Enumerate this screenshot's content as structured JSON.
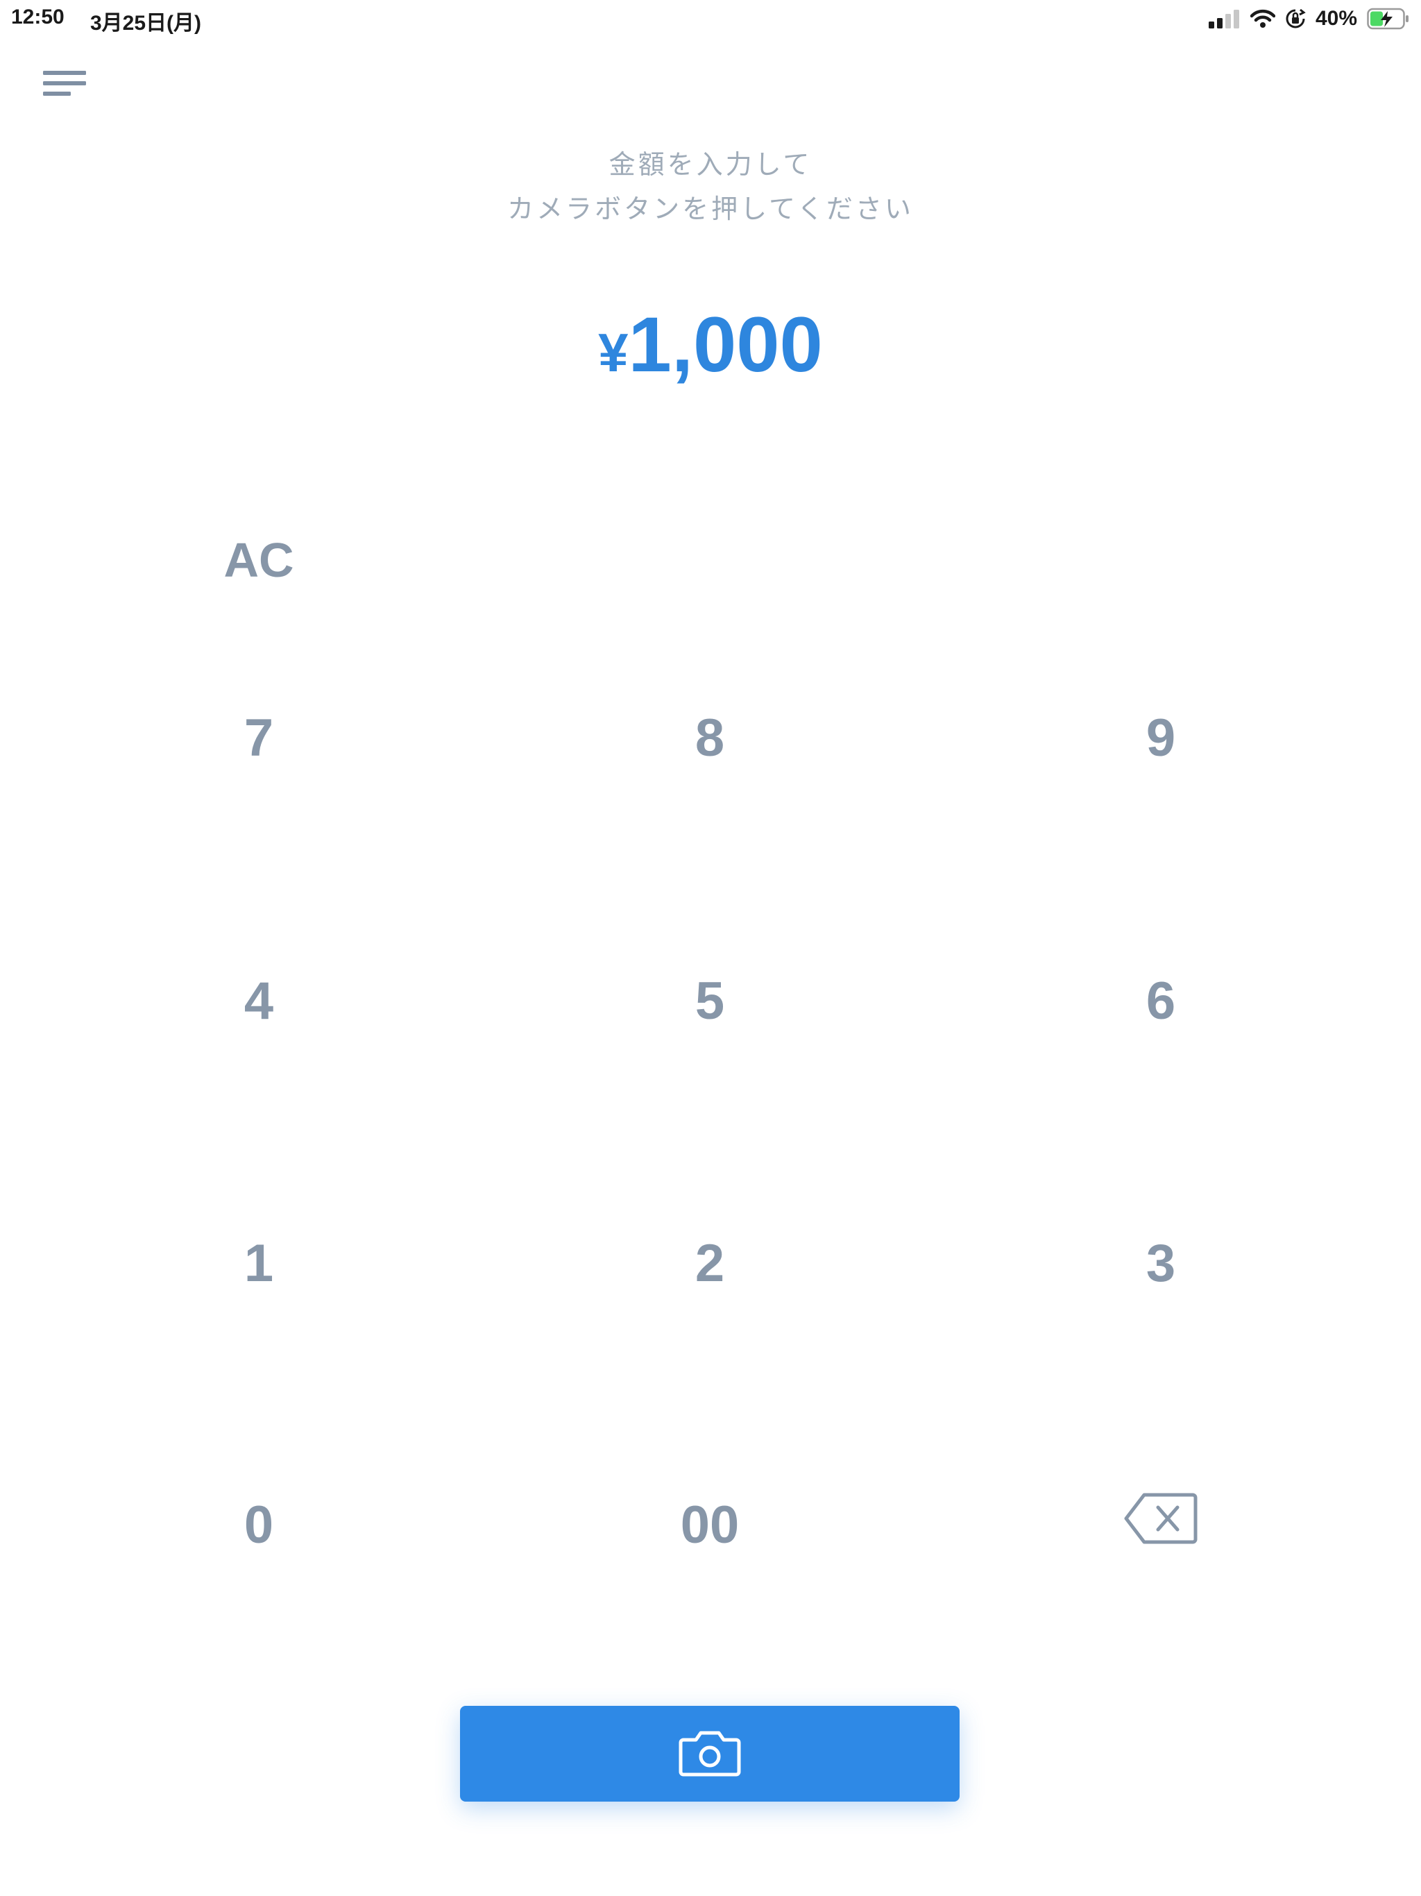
{
  "status_bar": {
    "time": "12:50",
    "date": "3月25日(月)",
    "battery_percent": "40%",
    "battery_level": 0.4,
    "signal_bars": 2
  },
  "header": {
    "menu_icon": "hamburger-menu-icon"
  },
  "instructions": {
    "line1": "金額を入力して",
    "line2": "カメラボタンを押してください"
  },
  "amount": {
    "currency": "¥",
    "value": "1,000"
  },
  "keypad": {
    "clear": "AC",
    "rows": [
      [
        "7",
        "8",
        "9"
      ],
      [
        "4",
        "5",
        "6"
      ],
      [
        "1",
        "2",
        "3"
      ],
      [
        "0",
        "00",
        "backspace"
      ]
    ],
    "backspace_icon": "backspace-icon"
  },
  "camera_button": {
    "icon": "camera-icon"
  },
  "colors": {
    "accent": "#2e89e6",
    "amount_text": "#2e86de",
    "key_text": "#8796a8",
    "instruction_text": "#9fabb8"
  }
}
